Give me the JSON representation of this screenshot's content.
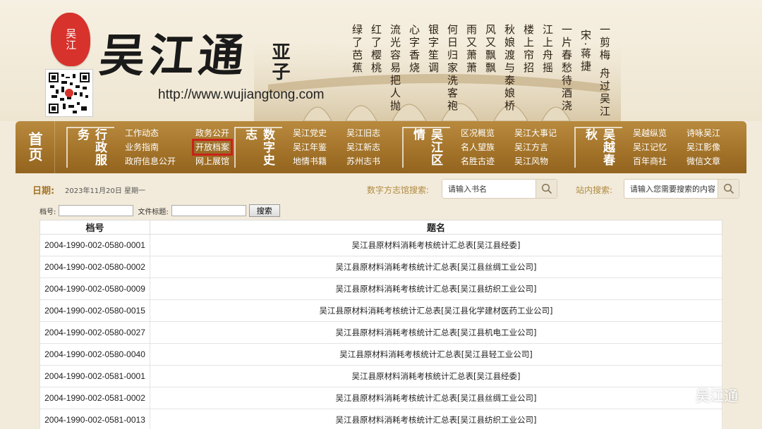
{
  "header": {
    "seal_text": "吴江",
    "logo_text": "吴江通",
    "logo_sub": "亚子",
    "url": "http://www.wujiangtong.com",
    "poem_title": "一剪梅 舟过吴江",
    "poem_author": "宋·蒋捷",
    "poem_lines": [
      "一片春愁待酒浇",
      "江上舟摇",
      "楼上帘招",
      "秋娘渡与泰娘桥",
      "风又飘飘",
      "雨又萧萧",
      "何日归家洗客袍",
      "银字笙调",
      "心字香烧",
      "流光容易把人抛",
      "红了樱桃",
      "绿了芭蕉"
    ]
  },
  "nav": {
    "home": "首页",
    "groups": [
      {
        "title": "行政服务",
        "links": [
          "工作动态",
          "业务指南",
          "政府信息公开",
          "政务公开",
          "开放档案",
          "网上展馆"
        ]
      },
      {
        "title": "数字史志",
        "links": [
          "吴江党史",
          "吴江年鉴",
          "地情书籍",
          "吴江旧志",
          "吴江新志",
          "苏州志书"
        ]
      },
      {
        "title": "吴江区情",
        "links": [
          "区况概览",
          "名人望族",
          "名胜古迹",
          "吴江大事记",
          "吴江方言",
          "吴江风物"
        ]
      },
      {
        "title": "吴越春秋",
        "links": [
          "吴越纵览",
          "吴江记忆",
          "百年商社",
          "诗咏吴江",
          "吴江影像",
          "微信文章"
        ]
      }
    ]
  },
  "subbar": {
    "date_label": "日期:",
    "date": "2023年11月20日",
    "weekday": "星期一",
    "library_search_label": "数字方志馆搜索:",
    "library_search_placeholder": "请输入书名",
    "site_search_label": "站内搜索:",
    "site_search_placeholder": "请输入您需要搜索的内容"
  },
  "filter": {
    "code_label": "档号:",
    "title_label": "文件标题:",
    "search_button": "搜索"
  },
  "table": {
    "headers": [
      "档号",
      "题名"
    ],
    "rows": [
      [
        "2004-1990-002-0580-0001",
        "吴江县原材料消耗考核统计汇总表[吴江县经委]"
      ],
      [
        "2004-1990-002-0580-0002",
        "吴江县原材料消耗考核统计汇总表[吴江县丝绸工业公司]"
      ],
      [
        "2004-1990-002-0580-0009",
        "吴江县原材料消耗考核统计汇总表[吴江县纺织工业公司]"
      ],
      [
        "2004-1990-002-0580-0015",
        "吴江县原材料消耗考核统计汇总表[吴江县化学建材医药工业公司]"
      ],
      [
        "2004-1990-002-0580-0027",
        "吴江县原材料消耗考核统计汇总表[吴江县机电工业公司]"
      ],
      [
        "2004-1990-002-0580-0040",
        "吴江县原材料消耗考核统计汇总表[吴江县轻工业公司]"
      ],
      [
        "2004-1990-002-0581-0001",
        "吴江县原材料消耗考核统计汇总表[吴江县经委]"
      ],
      [
        "2004-1990-002-0581-0002",
        "吴江县原材料消耗考核统计汇总表[吴江县丝绸工业公司]"
      ],
      [
        "2004-1990-002-0581-0013",
        "吴江县原材料消耗考核统计汇总表[吴江县纺织工业公司]"
      ]
    ]
  },
  "watermark": "吴江通",
  "colors": {
    "nav_bg": "#a4742a",
    "highlight": "#c8221a",
    "accent": "#b08a40"
  }
}
